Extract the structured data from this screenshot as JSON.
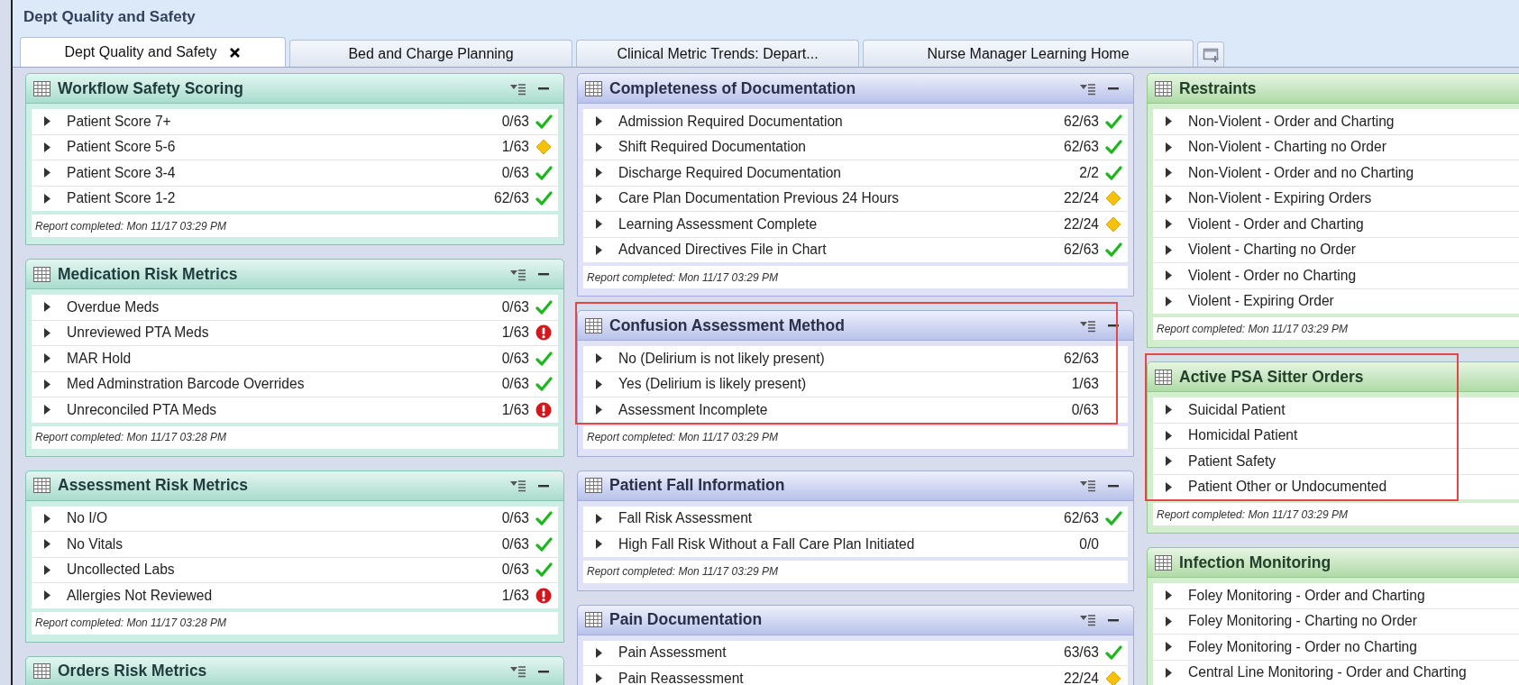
{
  "window": {
    "title": "Dept Quality and Safety"
  },
  "tabs": [
    {
      "label": "Dept Quality and Safety",
      "selected": true,
      "closable": true
    },
    {
      "label": "Bed and Charge Planning",
      "selected": false,
      "closable": false
    },
    {
      "label": "Clinical Metric Trends: Depart...",
      "selected": false,
      "closable": false
    },
    {
      "label": "Nurse Manager Learning Home",
      "selected": false,
      "closable": false
    }
  ],
  "columns": [
    {
      "show_tools": true,
      "panels": [
        {
          "title": "Workflow Safety Scoring",
          "highlighted": false,
          "rows": [
            {
              "label": "Patient Score 7+",
              "count": "0/63",
              "kind": "check"
            },
            {
              "label": "Patient Score 5-6",
              "count": "1/63",
              "kind": "diamond"
            },
            {
              "label": "Patient Score 3-4",
              "count": "0/63",
              "kind": "check"
            },
            {
              "label": "Patient Score 1-2",
              "count": "62/63",
              "kind": "check"
            }
          ],
          "footer": "Report completed: Mon 11/17 03:29 PM"
        },
        {
          "title": "Medication Risk Metrics",
          "highlighted": false,
          "rows": [
            {
              "label": "Overdue Meds",
              "count": "0/63",
              "kind": "check"
            },
            {
              "label": "Unreviewed PTA Meds",
              "count": "1/63",
              "kind": "alert"
            },
            {
              "label": "MAR Hold",
              "count": "0/63",
              "kind": "check"
            },
            {
              "label": "Med Adminstration Barcode Overrides",
              "count": "0/63",
              "kind": "check"
            },
            {
              "label": "Unreconciled PTA Meds",
              "count": "1/63",
              "kind": "alert"
            }
          ],
          "footer": "Report completed: Mon 11/17 03:28 PM"
        },
        {
          "title": "Assessment Risk Metrics",
          "highlighted": false,
          "rows": [
            {
              "label": "No I/O",
              "count": "0/63",
              "kind": "check"
            },
            {
              "label": "No Vitals",
              "count": "0/63",
              "kind": "check"
            },
            {
              "label": "Uncollected Labs",
              "count": "0/63",
              "kind": "check"
            },
            {
              "label": "Allergies Not Reviewed",
              "count": "1/63",
              "kind": "alert"
            }
          ],
          "footer": "Report completed: Mon 11/17 03:28 PM"
        },
        {
          "title": "Orders Risk Metrics",
          "highlighted": false
        }
      ]
    },
    {
      "show_tools": true,
      "panels": [
        {
          "title": "Completeness of Documentation",
          "highlighted": false,
          "rows": [
            {
              "label": "Admission Required Documentation",
              "count": "62/63",
              "kind": "check"
            },
            {
              "label": "Shift Required Documentation",
              "count": "62/63",
              "kind": "check"
            },
            {
              "label": "Discharge Required Documentation",
              "count": "2/2",
              "kind": "check"
            },
            {
              "label": "Care Plan Documentation Previous 24 Hours",
              "count": "22/24",
              "kind": "diamond"
            },
            {
              "label": "Learning Assessment Complete",
              "count": "22/24",
              "kind": "diamond"
            },
            {
              "label": "Advanced Directives File in Chart",
              "count": "62/63",
              "kind": "check"
            }
          ],
          "footer": "Report completed: Mon 11/17 03:29 PM"
        },
        {
          "title": "Confusion Assessment Method",
          "highlighted": true,
          "rows": [
            {
              "label": "No (Delirium is not likely present)",
              "count": "62/63",
              "kind": "plain"
            },
            {
              "label": "Yes (Delirium is likely present)",
              "count": "1/63",
              "kind": "plain"
            },
            {
              "label": "Assessment Incomplete",
              "count": "0/63",
              "kind": "plain"
            }
          ],
          "footer": "Report completed: Mon 11/17 03:29 PM"
        },
        {
          "title": "Patient Fall Information",
          "highlighted": false,
          "rows": [
            {
              "label": "Fall Risk Assessment",
              "count": "62/63",
              "kind": "check"
            },
            {
              "label": "High Fall Risk Without a Fall Care Plan Initiated",
              "count": "0/0",
              "kind": "plain"
            }
          ],
          "footer": "Report completed: Mon 11/17 03:29 PM"
        },
        {
          "title": "Pain Documentation",
          "highlighted": false,
          "rows": [
            {
              "label": "Pain Assessment",
              "count": "63/63",
              "kind": "check"
            },
            {
              "label": "Pain Reassessment",
              "count": "22/24",
              "kind": "diamond"
            }
          ]
        }
      ]
    },
    {
      "show_tools": false,
      "panels": [
        {
          "title": "Restraints",
          "highlighted": false,
          "rows": [
            {
              "label": "Non-Violent - Order and Charting",
              "kind": "plain"
            },
            {
              "label": "Non-Violent - Charting no Order",
              "kind": "plain"
            },
            {
              "label": "Non-Violent - Order and no Charting",
              "kind": "plain"
            },
            {
              "label": "Non-Violent - Expiring Orders",
              "kind": "plain"
            },
            {
              "label": "Violent - Order and Charting",
              "kind": "plain"
            },
            {
              "label": "Violent - Charting no Order",
              "kind": "plain"
            },
            {
              "label": "Violent - Order no Charting",
              "kind": "plain"
            },
            {
              "label": "Violent - Expiring Order",
              "kind": "plain"
            }
          ],
          "footer": "Report completed: Mon 11/17 03:29 PM"
        },
        {
          "title": "Active PSA Sitter Orders",
          "highlighted": true,
          "rows": [
            {
              "label": "Suicidal Patient",
              "kind": "plain"
            },
            {
              "label": "Homicidal Patient",
              "kind": "plain"
            },
            {
              "label": "Patient Safety",
              "kind": "plain"
            },
            {
              "label": "Patient Other or Undocumented",
              "kind": "plain"
            }
          ],
          "footer": "Report completed: Mon 11/17 03:29 PM"
        },
        {
          "title": "Infection Monitoring",
          "highlighted": false,
          "rows": [
            {
              "label": "Foley Monitoring - Order and Charting",
              "kind": "plain"
            },
            {
              "label": "Foley Monitoring - Charting no Order",
              "kind": "plain"
            },
            {
              "label": "Foley Monitoring - Order no Charting",
              "kind": "plain"
            },
            {
              "label": "Central Line Monitoring - Order and Charting",
              "kind": "plain"
            }
          ]
        }
      ]
    }
  ]
}
